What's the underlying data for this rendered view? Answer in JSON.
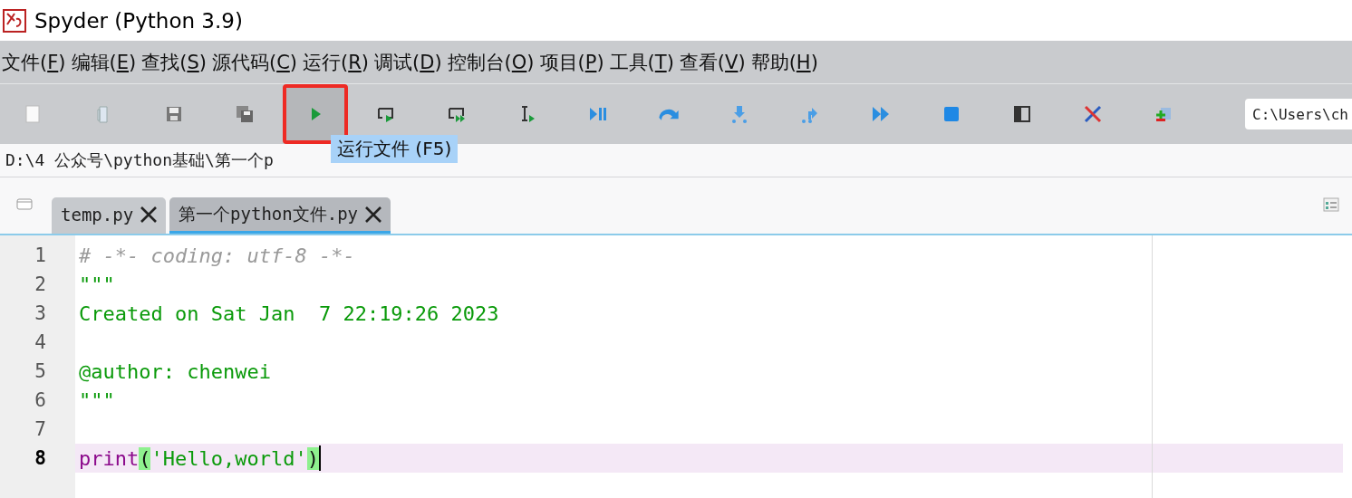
{
  "window": {
    "title": "Spyder (Python 3.9)"
  },
  "menu": [
    {
      "label": "文件(",
      "key": "F",
      "suffix": ")"
    },
    {
      "label": "编辑(",
      "key": "E",
      "suffix": ")"
    },
    {
      "label": "查找(",
      "key": "S",
      "suffix": ")"
    },
    {
      "label": "源代码(",
      "key": "C",
      "suffix": ")"
    },
    {
      "label": "运行(",
      "key": "R",
      "suffix": ")"
    },
    {
      "label": "调试(",
      "key": "D",
      "suffix": ")"
    },
    {
      "label": "控制台(",
      "key": "O",
      "suffix": ")"
    },
    {
      "label": "项目(",
      "key": "P",
      "suffix": ")"
    },
    {
      "label": "工具(",
      "key": "T",
      "suffix": ")"
    },
    {
      "label": "查看(",
      "key": "V",
      "suffix": ")"
    },
    {
      "label": "帮助(",
      "key": "H",
      "suffix": ")"
    }
  ],
  "toolbar": {
    "buttons": [
      {
        "selected": false
      },
      {
        "selected": false
      },
      {
        "selected": false
      },
      {
        "selected": false
      },
      {
        "selected": true
      },
      {
        "selected": false
      },
      {
        "selected": false
      },
      {
        "selected": false
      },
      {
        "selected": false
      },
      {
        "selected": false
      },
      {
        "selected": false
      },
      {
        "selected": false
      },
      {
        "selected": false
      },
      {
        "selected": false
      },
      {
        "selected": false
      },
      {
        "selected": false
      },
      {
        "selected": false
      }
    ],
    "tooltip": "运行文件 (F5)",
    "directory": "C:\\Users\\ch"
  },
  "path_bar": "D:\\4 公众号\\python基础\\第一个p",
  "tabs": [
    {
      "label": "temp.py",
      "selected": false
    },
    {
      "label": "第一个python文件.py",
      "selected": true
    }
  ],
  "editor": {
    "lines": [
      {
        "number": "1",
        "current": false,
        "tokens": [
          {
            "kind": "comment",
            "text": "# -*- coding: utf-8 -*-"
          }
        ]
      },
      {
        "number": "2",
        "current": false,
        "tokens": [
          {
            "kind": "string",
            "text": "\"\"\""
          }
        ]
      },
      {
        "number": "3",
        "current": false,
        "tokens": [
          {
            "kind": "string",
            "text": "Created on Sat Jan  7 22:19:26 2023"
          }
        ]
      },
      {
        "number": "4",
        "current": false
      },
      {
        "number": "5",
        "current": false,
        "tokens": [
          {
            "kind": "string",
            "text": "@author: chenwei"
          }
        ]
      },
      {
        "number": "6",
        "current": false,
        "tokens": [
          {
            "kind": "string",
            "text": "\"\"\""
          }
        ]
      },
      {
        "number": "7",
        "current": false
      },
      {
        "number": "8",
        "current": true,
        "cursor": true,
        "tokens": [
          {
            "kind": "builtin",
            "text": "print"
          },
          {
            "kind": "match",
            "text": "("
          },
          {
            "kind": "string",
            "text": "'Hello,world'"
          },
          {
            "kind": "match",
            "text": ")"
          }
        ]
      }
    ]
  }
}
